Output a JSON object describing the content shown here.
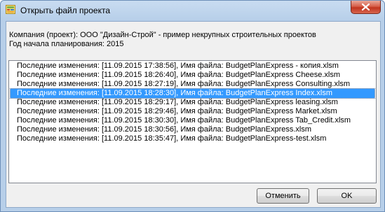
{
  "window": {
    "title": "Открыть файл проекта",
    "close_icon": "close-icon",
    "app_icon": "project-icon"
  },
  "info": {
    "company": "Компания (проект): ООО \"Дизайн-Строй\" - пример некрупных строительных проектов",
    "start_year": "Год начала планирования: 2015"
  },
  "files": [
    "Последние изменения: [11.09.2015 17:38:56],  Имя файла: BudgetPlanExpress - копия.xlsm",
    "Последние изменения: [11.09.2015 18:26:40],  Имя файла: BudgetPlanExpress Cheese.xlsm",
    "Последние изменения: [11.09.2015 18:27:19],  Имя файла: BudgetPlanExpress Consulting.xlsm",
    "Последние изменения: [11.09.2015 18:28:30],  Имя файла: BudgetPlanExpress Index.xlsm",
    "Последние изменения: [11.09.2015 18:29:17],  Имя файла: BudgetPlanExpress leasing.xlsm",
    "Последние изменения: [11.09.2015 18:29:46],  Имя файла: BudgetPlanExpress Market.xlsm",
    "Последние изменения: [11.09.2015 18:30:30],  Имя файла: BudgetPlanExpress Tab_Credit.xlsm",
    "Последние изменения: [11.09.2015 18:30:56],  Имя файла: BudgetPlanExpress.xlsm",
    "Последние изменения: [11.09.2015 18:35:47],  Имя файла: BudgetPlanExpress-test.xlsm"
  ],
  "selected_index": 3,
  "buttons": {
    "cancel": "Отменить",
    "ok": "OK"
  },
  "colors": {
    "selection": "#3399ff",
    "title_bar": "#b7cfe9",
    "close_button": "#c1341f"
  }
}
